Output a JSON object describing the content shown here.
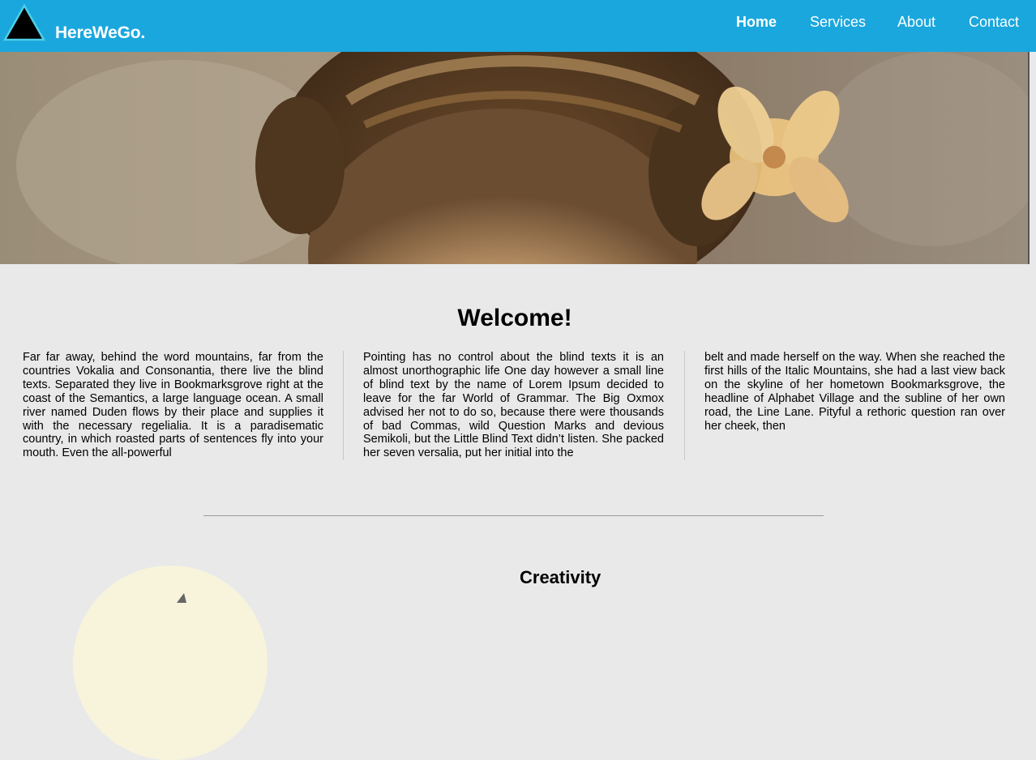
{
  "brand": {
    "name": "HereWeGo.",
    "logo_icon": "triangle-logo-icon",
    "colors": {
      "navbar": "#1aa7dd",
      "logo_fill": "#000000",
      "logo_stroke": "#4fd0e8"
    }
  },
  "nav": {
    "items": [
      {
        "label": "Home",
        "active": true
      },
      {
        "label": "Services",
        "active": false
      },
      {
        "label": "About",
        "active": false
      },
      {
        "label": "Contact",
        "active": false
      }
    ]
  },
  "hero": {
    "image": "portrait-photo",
    "alt_icon": "hero-image"
  },
  "welcome": {
    "title": "Welcome!",
    "columns": [
      "Far far away, behind the word mountains, far from the countries Vokalia and Consonantia, there live the blind texts. Separated they live in Bookmarksgrove right at the coast of the Semantics, a large language ocean. A small river named Duden flows by their place and supplies it with the necessary regelialia. It is a paradisematic country, in which roasted parts of sentences fly into your mouth. Even the all-powerful",
      "Pointing has no control about the blind texts it is an almost unorthographic life One day however a small line of blind text by the name of Lorem Ipsum decided to leave for the far World of Grammar. The Big Oxmox advised her not to do so, because there were thousands of bad Commas, wild Question Marks and devious Semikoli, but the Little Blind Text didn’t listen. She packed her seven versalia, put her initial into the",
      "belt and made herself on the way. When she reached the first hills of the Italic Mountains, she had a last view back on the skyline of her hometown Bookmarksgrove, the headline of Alphabet Village and the subline of her own road, the Line Lane. Pityful a rethoric question ran over her cheek, then"
    ]
  },
  "creativity": {
    "title": "Creativity",
    "icon": "creativity-icon"
  }
}
